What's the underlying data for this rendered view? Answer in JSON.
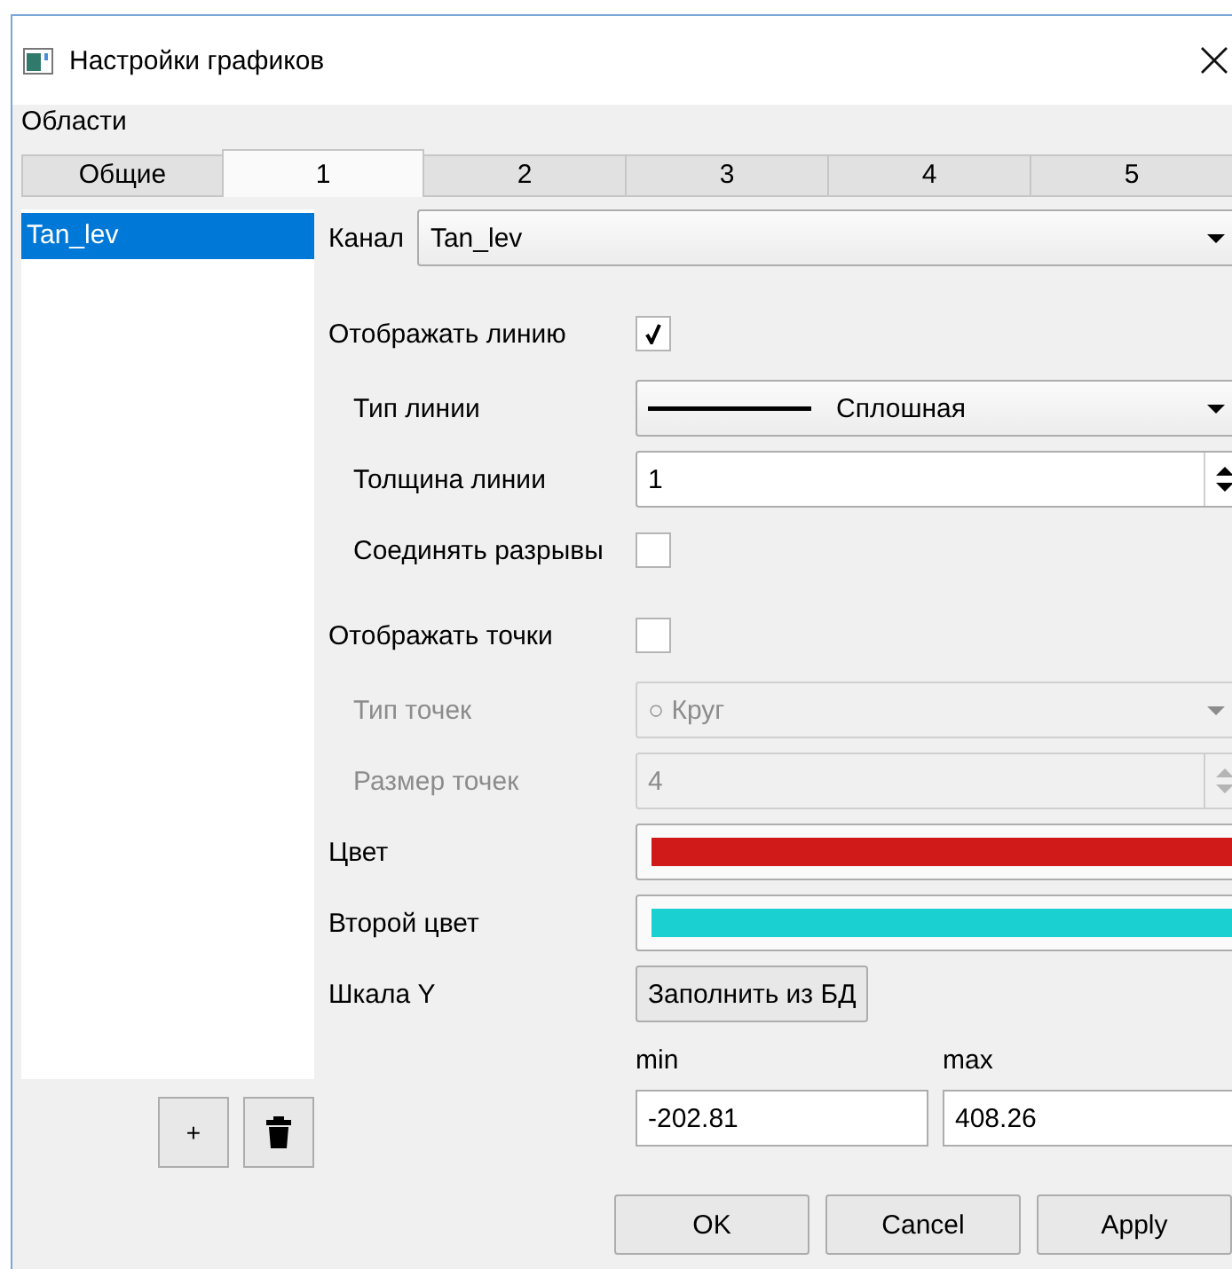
{
  "window": {
    "title": "Настройки графиков"
  },
  "areas_label": "Области",
  "tabs": [
    {
      "label": "Общие",
      "selected": false
    },
    {
      "label": "1",
      "selected": true
    },
    {
      "label": "2",
      "selected": false
    },
    {
      "label": "3",
      "selected": false
    },
    {
      "label": "4",
      "selected": false
    },
    {
      "label": "5",
      "selected": false
    }
  ],
  "channel_list": {
    "items": [
      {
        "label": "Tan_lev",
        "selected": true
      }
    ],
    "buttons": [
      {
        "kind": "add",
        "label": "+"
      },
      {
        "kind": "delete"
      }
    ]
  },
  "channel": {
    "label": "Канал",
    "value": "Tan_lev"
  },
  "options": [
    {
      "kind": "checkbox",
      "label": "Отображать линию",
      "checked": true,
      "children": [
        {
          "kind": "line-combo",
          "label": "Тип линии",
          "value": "Сплошная",
          "disabled": false
        },
        {
          "kind": "spin",
          "label": "Толщина линии",
          "value": "1",
          "disabled": false
        },
        {
          "kind": "checkbox",
          "label": "Соединять разрывы",
          "checked": false
        }
      ]
    },
    {
      "kind": "checkbox",
      "label": "Отображать точки",
      "checked": false,
      "children": [
        {
          "kind": "combo",
          "label": "Тип точек",
          "value": "○ Круг",
          "disabled": true
        },
        {
          "kind": "spin",
          "label": "Размер точек",
          "value": "4",
          "disabled": true
        }
      ]
    },
    {
      "kind": "color",
      "label": "Цвет",
      "color": "#d01a1a"
    },
    {
      "kind": "color",
      "label": "Второй цвет",
      "color": "#1ad0d0"
    },
    {
      "kind": "button",
      "label": "Шкала Y",
      "button": "Заполнить из БД"
    }
  ],
  "range": {
    "min_label": "min",
    "min": "-202.81",
    "max_label": "max",
    "max": "408.26"
  },
  "buttons": [
    {
      "label": "OK"
    },
    {
      "label": "Cancel"
    },
    {
      "label": "Apply"
    }
  ]
}
